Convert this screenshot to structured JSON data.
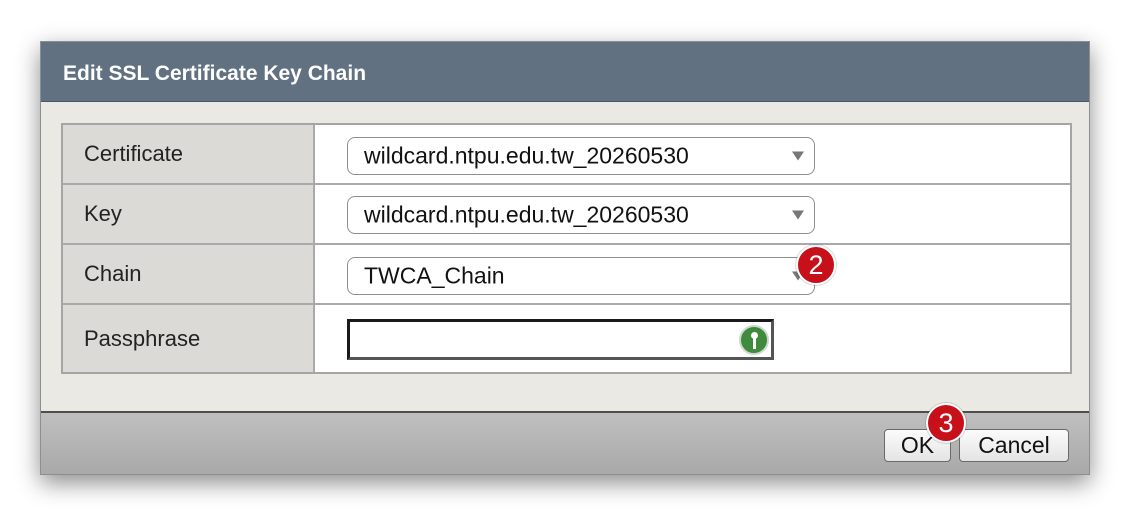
{
  "dialog": {
    "title": "Edit SSL Certificate Key Chain"
  },
  "form": {
    "certificate": {
      "label": "Certificate",
      "value": "wildcard.ntpu.edu.tw_20260530"
    },
    "key": {
      "label": "Key",
      "value": "wildcard.ntpu.edu.tw_20260530"
    },
    "chain": {
      "label": "Chain",
      "value": "TWCA_Chain"
    },
    "passphrase": {
      "label": "Passphrase",
      "value": ""
    }
  },
  "footer": {
    "ok_label": "OK",
    "cancel_label": "Cancel"
  },
  "annotations": {
    "step_2": "2",
    "step_3": "3"
  },
  "colors": {
    "titlebar": "#617182",
    "dialog_bg": "#ebe9e3",
    "label_bg": "#dcdad6",
    "badge": "#c8101a"
  },
  "icons": {
    "passphrase_helper": "key-icon",
    "dropdown": "chevron-down-icon"
  }
}
